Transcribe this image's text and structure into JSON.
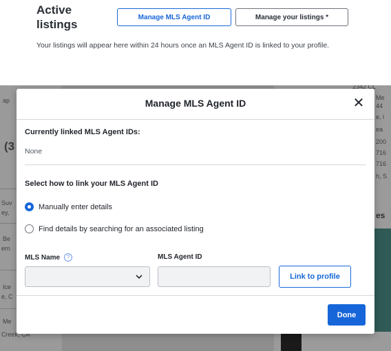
{
  "page": {
    "section_title": "Active listings",
    "manage_mls_button": "Manage MLS Agent ID",
    "manage_listings_button": "Manage your listings *",
    "info_text": "Your listings will appear here within 24 hours once an MLS Agent ID is linked to your profile."
  },
  "background_fragments": {
    "left": [
      "ap",
      "(3",
      "Suv",
      "ey,",
      "Be",
      "ern",
      "Ice",
      "e, C",
      "Me",
      "Creek, CA"
    ],
    "right": [
      "2342 CL",
      "Me",
      "44",
      "e, l",
      "ea",
      "200",
      "716",
      "716",
      "h, S",
      "es"
    ]
  },
  "modal": {
    "title": "Manage MLS Agent ID",
    "close_glyph": "✕",
    "linked_label": "Currently linked MLS Agent IDs:",
    "linked_value": "None",
    "link_method_label": "Select how to link your MLS Agent ID",
    "options": [
      {
        "label": "Manually enter details",
        "selected": true
      },
      {
        "label": "Find details by searching for an associated listing",
        "selected": false
      }
    ],
    "mls_name_label": "MLS Name",
    "mls_name_value": "",
    "mls_agent_id_label": "MLS Agent ID",
    "mls_agent_id_value": "",
    "mls_agent_id_placeholder": "",
    "link_button": "Link to profile",
    "done_button": "Done"
  },
  "colors": {
    "accent": "#1766d9",
    "backdrop": "#8e8e8e"
  },
  "icons": {
    "close": "close-icon",
    "help": "help-icon",
    "dropdown": "chevron-down-icon"
  }
}
